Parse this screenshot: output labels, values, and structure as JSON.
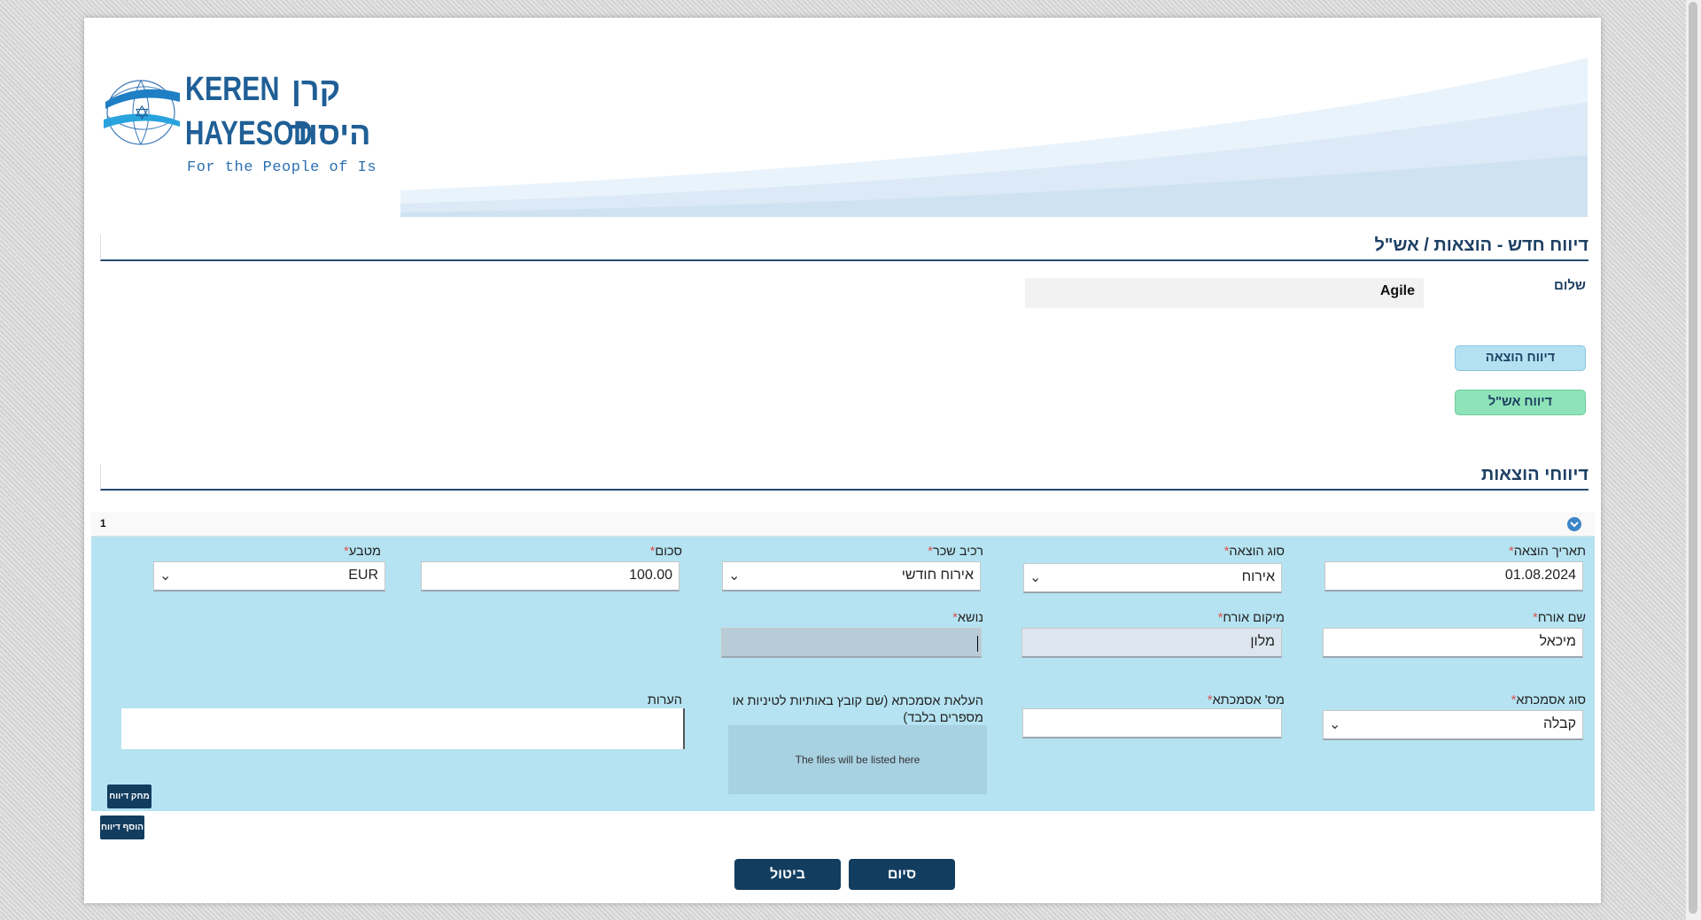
{
  "logo": {
    "text_en_1": "KEREN",
    "text_en_2": "HAYESOD",
    "text_he_1": "קרן",
    "text_he_2": "היסוד",
    "tagline": "For the People of Israel"
  },
  "report": {
    "title": "דיווח חדש - הוצאות / אש\"ל",
    "hello_label": "שלום",
    "user_name": "Agile",
    "expense_report_button": "דיווח הוצאה",
    "ashal_report_button": "דיווח אש\"ל"
  },
  "expenses": {
    "section_title": "דיווחי הוצאות",
    "item_number": "1",
    "labels": {
      "expense_date": "תאריך הוצאה",
      "expense_type": "סוג הוצאה",
      "pay_component": "רכיב שכר",
      "amount": "סכום",
      "currency": "מטבע",
      "guest_name": "שם אורח",
      "guest_location": "מיקום אורח",
      "subject": "נושא",
      "reference_type": "סוג אסמכתא",
      "reference_number": "מס' אסמכתא",
      "upload": "העלאת אסמכתא (שם קובץ באותיות לטיניות או מספרים בלבד)",
      "notes": "הערות"
    },
    "required_mark": "*",
    "values": {
      "expense_date": "01.08.2024",
      "expense_type": "אירוח",
      "pay_component": "אירוח חודשי",
      "amount": "100.00",
      "currency": "EUR",
      "guest_name": "מיכאל",
      "guest_location": "מלון",
      "subject": "",
      "reference_type": "קבלה",
      "reference_number": "",
      "notes": ""
    },
    "dropzone_text": "The files will be listed here",
    "delete_button": "מחק דיווח",
    "add_button": "הוסף דיווח"
  },
  "footer": {
    "finish_button": "סיום",
    "cancel_button": "ביטול"
  },
  "colors": {
    "panel": "#b5e3f1",
    "primary": "#123d5f",
    "heading": "#1d3f63",
    "required": "#d9534f"
  }
}
